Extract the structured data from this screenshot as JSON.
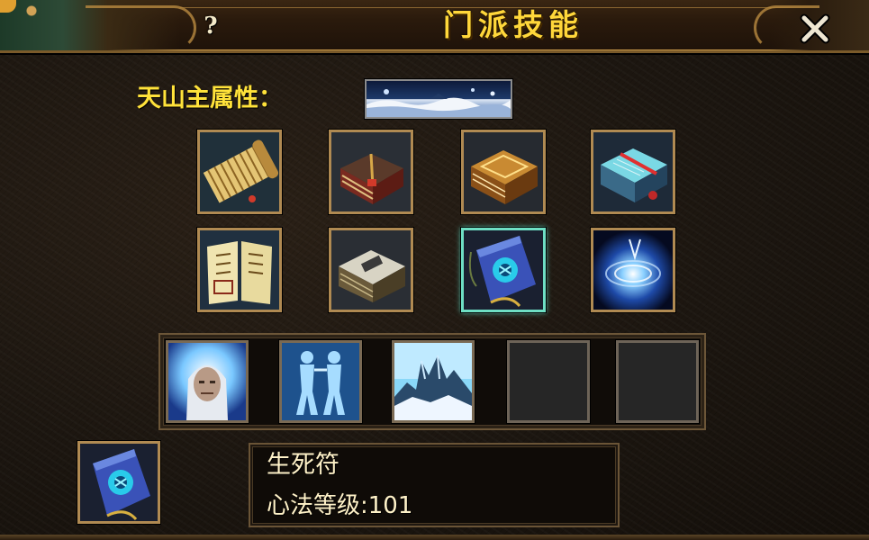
{
  "window": {
    "title": "门派技能",
    "help_label": "?",
    "close_icon": "close-x-icon"
  },
  "attribute": {
    "label": "天山主属性：",
    "icon": "snow-mountain-attribute-icon"
  },
  "skills": [
    {
      "icon": "bamboo-scroll-icon"
    },
    {
      "icon": "red-tied-book-icon"
    },
    {
      "icon": "golden-book-icon"
    },
    {
      "icon": "cyan-book-icon"
    },
    {
      "icon": "open-manual-icon"
    },
    {
      "icon": "silver-book-icon"
    },
    {
      "icon": "life-death-talisman-icon",
      "selected": true
    },
    {
      "icon": "blue-vortex-icon"
    }
  ],
  "methods": [
    {
      "icon": "white-haired-elder-icon"
    },
    {
      "icon": "twin-warriors-icon"
    },
    {
      "icon": "ice-palace-icon"
    },
    {
      "icon": "empty-slot"
    },
    {
      "icon": "empty-slot"
    }
  ],
  "selected": {
    "icon": "life-death-talisman-icon",
    "name": "生死符",
    "level_text": "心法等级:101"
  },
  "colors": {
    "title": "#ffd73a",
    "label": "#ffe23a",
    "slot_border": "#b08a52",
    "selected_border": "#6edfc4",
    "info_text": "#fff2c8"
  }
}
